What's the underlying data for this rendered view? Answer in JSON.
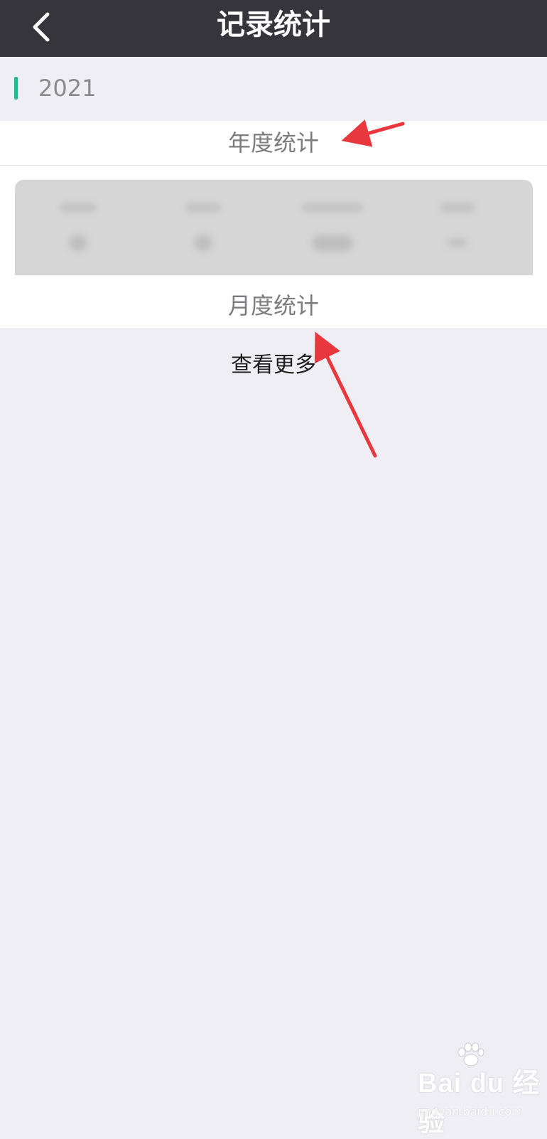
{
  "header": {
    "title": "记录统计",
    "back_icon": "chevron-left-icon"
  },
  "year_section": {
    "year": "2021",
    "accent_color": "#26b98f"
  },
  "annual_stats": {
    "heading": "年度统计"
  },
  "monthly_stats": {
    "heading": "月度统计",
    "more_label": "查看更多"
  },
  "watermark": {
    "logo": "Bai du 经验",
    "sub": "jingyan.baidu.com"
  },
  "colors": {
    "header_bg": "#36353b",
    "page_bg": "#efeef4",
    "annotation_arrow": "#e8383d"
  }
}
